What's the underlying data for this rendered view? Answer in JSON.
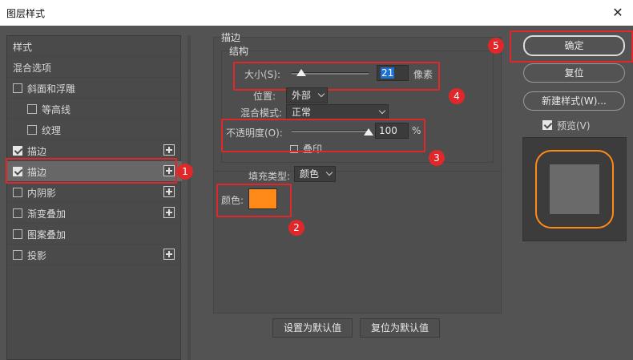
{
  "window": {
    "title": "图层样式",
    "close_glyph": "✕"
  },
  "left_panel": {
    "header_styles": "样式",
    "header_blend": "混合选项",
    "items": [
      {
        "label": "斜面和浮雕",
        "checked": false,
        "plus": false
      },
      {
        "label": "等高线",
        "checked": false,
        "plus": false
      },
      {
        "label": "纹理",
        "checked": false,
        "plus": false
      },
      {
        "label": "描边",
        "checked": true,
        "plus": true
      },
      {
        "label": "描边",
        "checked": true,
        "plus": true
      },
      {
        "label": "内阴影",
        "checked": false,
        "plus": true
      },
      {
        "label": "渐变叠加",
        "checked": false,
        "plus": true
      },
      {
        "label": "图案叠加",
        "checked": false,
        "plus": false
      },
      {
        "label": "投影",
        "checked": false,
        "plus": true
      }
    ]
  },
  "stroke": {
    "title": "描边",
    "structure_title": "结构",
    "size_label": "大小(S):",
    "size_value": "21",
    "size_unit": "像素",
    "position_label": "位置:",
    "position_value": "外部",
    "blend_label": "混合模式:",
    "blend_value": "正常",
    "opacity_label": "不透明度(O):",
    "opacity_value": "100",
    "opacity_unit": "%",
    "overprint_label": "叠印",
    "fill_type_label": "填充类型:",
    "fill_type_value": "颜色",
    "color_label": "颜色:",
    "color_value": "#ff8a17",
    "set_default": "设置为默认值",
    "reset_default": "复位为默认值"
  },
  "right_panel": {
    "ok": "确定",
    "reset": "复位",
    "new_style": "新建样式(W)...",
    "preview_label": "预览(V)",
    "preview_checked": true
  },
  "annotations": {
    "badge1": "1",
    "badge2": "2",
    "badge3": "3",
    "badge4": "4",
    "badge5": "5",
    "accent": "#e0282b"
  }
}
